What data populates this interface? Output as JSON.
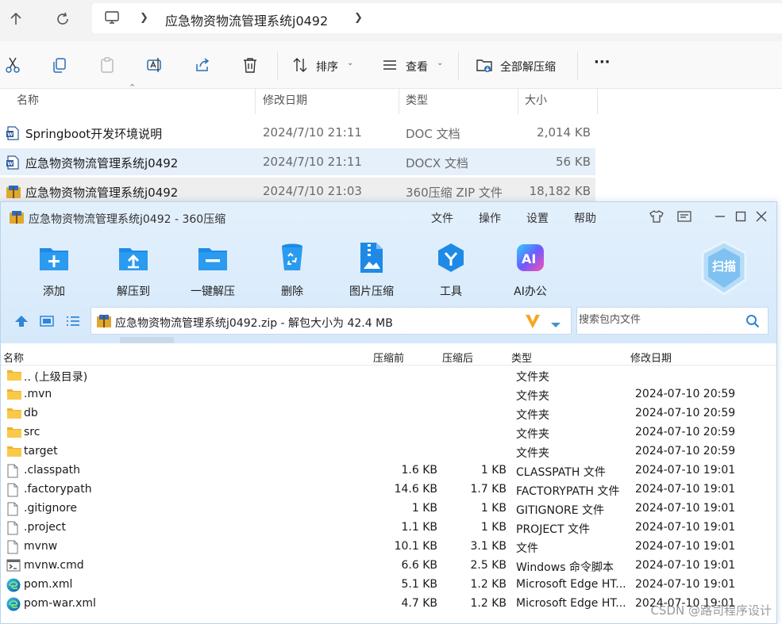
{
  "explorer": {
    "breadcrumb": "应急物资物流管理系统j0492",
    "toolbar": {
      "sort_label": "排序",
      "view_label": "查看",
      "extract_all_label": "全部解压缩",
      "more_label": "···"
    },
    "columns": {
      "name": "名称",
      "date": "修改日期",
      "type": "类型",
      "size": "大小"
    },
    "files": [
      {
        "name": "Springboot开发环境说明",
        "date": "2024/7/10 21:11",
        "type": "DOC 文档",
        "size": "2,014 KB",
        "icon": "word-doc-icon"
      },
      {
        "name": "应急物资物流管理系统j0492",
        "date": "2024/7/10 21:11",
        "type": "DOCX 文档",
        "size": "56 KB",
        "icon": "word-doc-icon"
      },
      {
        "name": "应急物资物流管理系统j0492",
        "date": "2024/7/10 21:03",
        "type": "360压缩 ZIP 文件",
        "size": "18,182 KB",
        "icon": "zip-archive-icon"
      }
    ]
  },
  "zipwin": {
    "title": "应急物资物流管理系统j0492 - 360压缩",
    "menu": [
      "文件",
      "操作",
      "设置",
      "帮助"
    ],
    "tools": [
      "添加",
      "解压到",
      "一键解压",
      "删除",
      "图片压缩",
      "工具",
      "AI办公"
    ],
    "scan_label": "扫描",
    "path_text": "应急物资物流管理系统j0492.zip - 解包大小为 42.4 MB",
    "search_placeholder": "搜索包内文件",
    "columns": {
      "name": "名称",
      "before": "压缩前",
      "after": "压缩后",
      "type": "类型",
      "date": "修改日期"
    },
    "rows": [
      {
        "name": ".. (上级目录)",
        "before": "",
        "after": "",
        "type": "文件夹",
        "date": "",
        "icon": "folder-icon"
      },
      {
        "name": ".mvn",
        "before": "",
        "after": "",
        "type": "文件夹",
        "date": "2024-07-10 20:59",
        "icon": "folder-icon"
      },
      {
        "name": "db",
        "before": "",
        "after": "",
        "type": "文件夹",
        "date": "2024-07-10 20:59",
        "icon": "folder-icon"
      },
      {
        "name": "src",
        "before": "",
        "after": "",
        "type": "文件夹",
        "date": "2024-07-10 20:59",
        "icon": "folder-icon"
      },
      {
        "name": "target",
        "before": "",
        "after": "",
        "type": "文件夹",
        "date": "2024-07-10 20:59",
        "icon": "folder-icon"
      },
      {
        "name": ".classpath",
        "before": "1.6 KB",
        "after": "1 KB",
        "type": "CLASSPATH 文件",
        "date": "2024-07-10 19:01",
        "icon": "file-icon"
      },
      {
        "name": ".factorypath",
        "before": "14.6 KB",
        "after": "1.7 KB",
        "type": "FACTORYPATH 文件",
        "date": "2024-07-10 19:01",
        "icon": "file-icon"
      },
      {
        "name": ".gitignore",
        "before": "1 KB",
        "after": "1 KB",
        "type": "GITIGNORE 文件",
        "date": "2024-07-10 19:01",
        "icon": "file-icon"
      },
      {
        "name": ".project",
        "before": "1.1 KB",
        "after": "1 KB",
        "type": "PROJECT 文件",
        "date": "2024-07-10 19:01",
        "icon": "file-icon"
      },
      {
        "name": "mvnw",
        "before": "10.1 KB",
        "after": "3.1 KB",
        "type": "文件",
        "date": "2024-07-10 19:01",
        "icon": "file-icon"
      },
      {
        "name": "mvnw.cmd",
        "before": "6.6 KB",
        "after": "2.5 KB",
        "type": "Windows 命令脚本",
        "date": "2024-07-10 19:01",
        "icon": "cmd-script-icon"
      },
      {
        "name": "pom.xml",
        "before": "5.1 KB",
        "after": "1.2 KB",
        "type": "Microsoft Edge HT...",
        "date": "2024-07-10 19:01",
        "icon": "edge-icon"
      },
      {
        "name": "pom-war.xml",
        "before": "4.7 KB",
        "after": "1.2 KB",
        "type": "Microsoft Edge HT...",
        "date": "2024-07-10 19:01",
        "icon": "edge-icon"
      }
    ]
  },
  "watermark": "CSDN @路司程序设计"
}
